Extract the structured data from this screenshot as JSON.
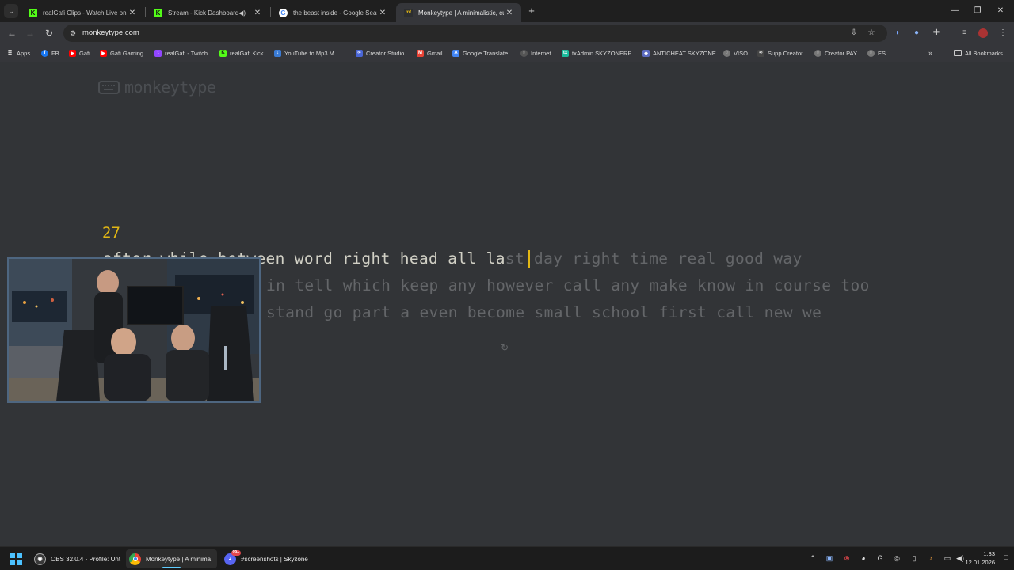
{
  "browser": {
    "tabs": [
      {
        "title": "realGafi Clips - Watch Live on K",
        "favicon": "kick-icon",
        "color": "#53fc18"
      },
      {
        "title": "Stream - Kick Dashboard",
        "favicon": "kick-icon",
        "color": "#53fc18"
      },
      {
        "title": "the beast inside - Google Searc",
        "favicon": "google-icon",
        "color": "#ffffff"
      },
      {
        "title": "Monkeytype | A minimalistic, cu",
        "favicon": "monkeytype-icon",
        "color": "#e2b714"
      }
    ],
    "new_tab": "+",
    "url": "monkeytype.com",
    "bookmarks": [
      {
        "label": "Apps",
        "color": "#9a9a9a"
      },
      {
        "label": "FB",
        "color": "#1877f2"
      },
      {
        "label": "Gafi",
        "color": "#ff0000"
      },
      {
        "label": "Gafi Gaming",
        "color": "#ff0000"
      },
      {
        "label": "realGafi - Twitch",
        "color": "#9146ff"
      },
      {
        "label": "realGafi Kick",
        "color": "#53fc18"
      },
      {
        "label": "YouTube to Mp3 M...",
        "color": "#3a7bd5"
      },
      {
        "label": "Creator Studio",
        "color": "#4a66d6"
      },
      {
        "label": "Gmail",
        "color": "#ea4335"
      },
      {
        "label": "Google Translate",
        "color": "#4285f4"
      },
      {
        "label": "Internet",
        "color": "#555555"
      },
      {
        "label": "txAdmin SKYZONERP",
        "color": "#1abc9c"
      },
      {
        "label": "ANTICHEAT SKYZONE",
        "color": "#5c6bc0"
      },
      {
        "label": "VISO",
        "color": "#777777"
      },
      {
        "label": "Supp Creator",
        "color": "#444444"
      },
      {
        "label": "Creator PAY",
        "color": "#777777"
      },
      {
        "label": "ES",
        "color": "#777777"
      }
    ],
    "all_bookmarks": "All Bookmarks"
  },
  "page": {
    "logo": "monkeytype",
    "word_counter": "27",
    "line1_typed": "after while between word right head all la",
    "line1_untyped": "st day right time real good way",
    "line2": "in tell which keep any however call any make know in course too",
    "line3": "stand go part a even become small school first call new we",
    "colors": {
      "accent": "#e2b714",
      "text": "#d1d0c5",
      "sub": "#646669",
      "bg": "#323437"
    }
  },
  "taskbar": {
    "items": [
      {
        "label": "OBS 32.0.4 - Profile: Unt",
        "color": "#3a3a3a"
      },
      {
        "label": "Monkeytype | A minima",
        "color": "#4285f4"
      },
      {
        "label": "#screenshots | Skyzone",
        "color": "#5865f2"
      }
    ],
    "discord_badge": "99+",
    "time": "1:33",
    "date": "12.01.2026"
  }
}
